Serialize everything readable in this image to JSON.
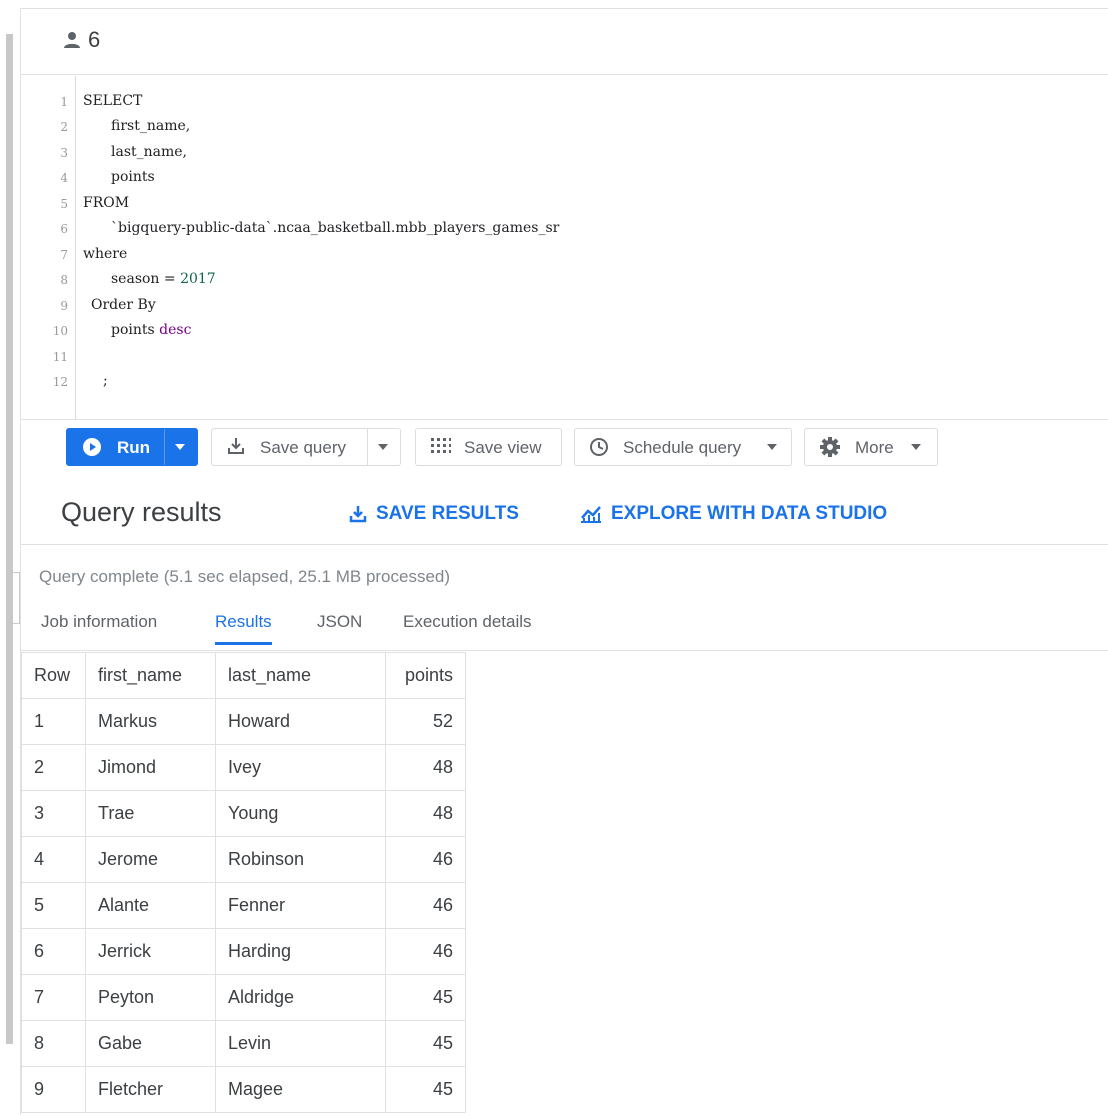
{
  "header": {
    "user_count": "6",
    "user_icon": "person-icon"
  },
  "editor": {
    "line_numbers": [
      "1",
      "2",
      "3",
      "4",
      "5",
      "6",
      "7",
      "8",
      "9",
      "10",
      "11",
      "12"
    ],
    "lines": [
      "SELECT",
      "first_name,",
      "last_name,",
      "points",
      "FROM",
      "`bigquery-public-data`.ncaa_basketball.mbb_players_games_sr",
      "where",
      "season = ",
      "Order By",
      "points ",
      "",
      ";"
    ],
    "season_value": "2017",
    "desc_keyword": "desc"
  },
  "toolbar": {
    "run_label": "Run",
    "save_query_label": "Save query",
    "save_view_label": "Save view",
    "schedule_query_label": "Schedule query",
    "more_label": "More"
  },
  "results": {
    "title": "Query results",
    "save_results_label": "SAVE RESULTS",
    "explore_label": "EXPLORE WITH DATA STUDIO",
    "status": "Query complete (5.1 sec elapsed, 25.1 MB processed)",
    "tabs": [
      {
        "label": "Job information"
      },
      {
        "label": "Results"
      },
      {
        "label": "JSON"
      },
      {
        "label": "Execution details"
      }
    ],
    "active_tab": "Results",
    "columns": [
      "Row",
      "first_name",
      "last_name",
      "points"
    ],
    "rows": [
      [
        "1",
        "Markus",
        "Howard",
        "52"
      ],
      [
        "2",
        "Jimond",
        "Ivey",
        "48"
      ],
      [
        "3",
        "Trae",
        "Young",
        "48"
      ],
      [
        "4",
        "Jerome",
        "Robinson",
        "46"
      ],
      [
        "5",
        "Alante",
        "Fenner",
        "46"
      ],
      [
        "6",
        "Jerrick",
        "Harding",
        "46"
      ],
      [
        "7",
        "Peyton",
        "Aldridge",
        "45"
      ],
      [
        "8",
        "Gabe",
        "Levin",
        "45"
      ],
      [
        "9",
        "Fletcher",
        "Magee",
        "45"
      ]
    ]
  },
  "colors": {
    "accent": "#1a73e8",
    "keyword": "#770088",
    "number": "#116644"
  }
}
